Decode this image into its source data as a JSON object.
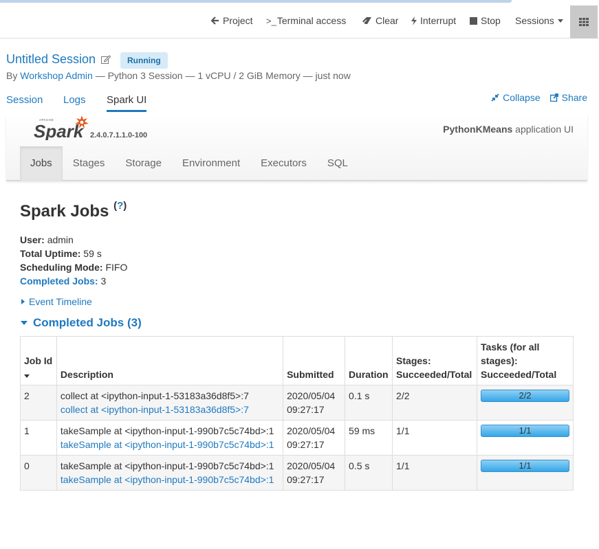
{
  "toolbar": {
    "project": "Project",
    "terminal": "Terminal access",
    "clear": "Clear",
    "interrupt": "Interrupt",
    "stop": "Stop",
    "sessions": "Sessions"
  },
  "session": {
    "title": "Untitled Session",
    "status": "Running",
    "by_prefix": "By",
    "owner": "Workshop Admin",
    "details": "— Python 3 Session — 1 vCPU / 2 GiB Memory — just now"
  },
  "session_tabs": [
    "Session",
    "Logs",
    "Spark UI"
  ],
  "right_links": {
    "collapse": "Collapse",
    "share": "Share"
  },
  "spark": {
    "version": "2.4.0.7.1.1.0-100",
    "app_name": "PythonKMeans",
    "app_suffix": "application UI",
    "nav": [
      "Jobs",
      "Stages",
      "Storage",
      "Environment",
      "Executors",
      "SQL"
    ],
    "page_title": "Spark Jobs",
    "help": "?",
    "user_label": "User:",
    "user": "admin",
    "uptime_label": "Total Uptime:",
    "uptime": "59 s",
    "sched_label": "Scheduling Mode:",
    "sched": "FIFO",
    "completed_label": "Completed Jobs:",
    "completed": "3",
    "event_timeline": "Event Timeline",
    "completed_header": "Completed Jobs (3)"
  },
  "table": {
    "headers": [
      "Job Id",
      "Description",
      "Submitted",
      "Duration",
      "Stages: Succeeded/Total",
      "Tasks (for all stages): Succeeded/Total"
    ],
    "rows": [
      {
        "id": "2",
        "desc": "collect at <ipython-input-1-53183a36d8f5>:7",
        "link": "collect at <ipython-input-1-53183a36d8f5>:7",
        "date": "2020/05/04",
        "time": "09:27:17",
        "duration": "0.1 s",
        "stages": "2/2",
        "tasks": "2/2",
        "progress": 1.0
      },
      {
        "id": "1",
        "desc": "takeSample at <ipython-input-1-990b7c5c74bd>:1",
        "link": "takeSample at <ipython-input-1-990b7c5c74bd>:1",
        "date": "2020/05/04",
        "time": "09:27:17",
        "duration": "59 ms",
        "stages": "1/1",
        "tasks": "1/1",
        "progress": 1.0
      },
      {
        "id": "0",
        "desc": "takeSample at <ipython-input-1-990b7c5c74bd>:1",
        "link": "takeSample at <ipython-input-1-990b7c5c74bd>:1",
        "date": "2020/05/04",
        "time": "09:27:17",
        "duration": "0.5 s",
        "stages": "1/1",
        "tasks": "1/1",
        "progress": 1.0
      }
    ]
  },
  "colors": {
    "link": "#1e79bf",
    "badge_bg": "#d6ebf7",
    "progress": "#35a7e8"
  }
}
